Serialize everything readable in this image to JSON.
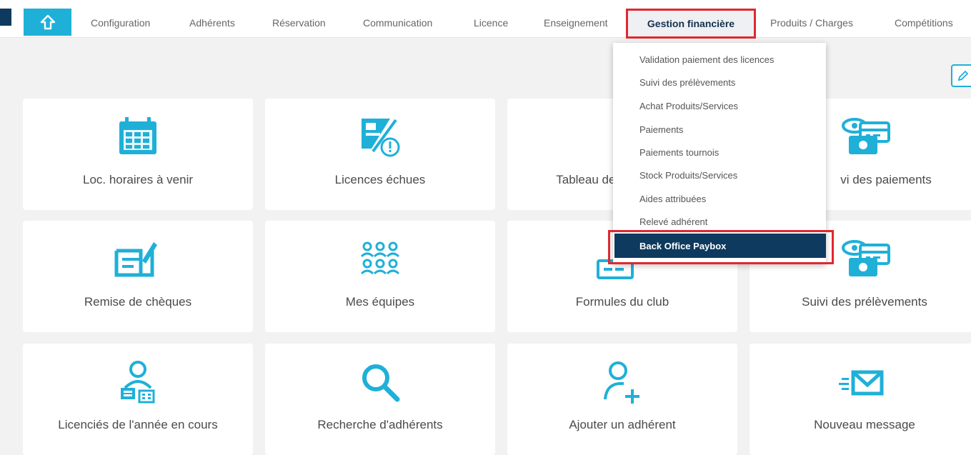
{
  "nav": {
    "items": [
      "Configuration",
      "Adhérents",
      "Réservation",
      "Communication",
      "Licence",
      "Enseignement"
    ],
    "active": "Gestion financière",
    "after": [
      "Produits / Charges",
      "Compétitions"
    ]
  },
  "dropdown": {
    "items": [
      "Validation paiement des licences",
      "Suivi des prélèvements",
      "Achat Produits/Services",
      "Paiements",
      "Paiements tournois",
      "Stock Produits/Services",
      "Aides attribuées",
      "Relevé adhérent"
    ],
    "selected": "Back Office Paybox"
  },
  "tiles": {
    "row1": [
      "Loc. horaires à venir",
      "Licences échues",
      "Tableau de rés",
      "vi des paiements"
    ],
    "row2": [
      "Remise de chèques",
      "Mes équipes",
      "Formules du club",
      "Suivi des prélèvements"
    ],
    "row3": [
      "Licenciés de l'année en cours",
      "Recherche d'adhérents",
      "Ajouter un adhérent",
      "Nouveau message"
    ]
  },
  "colors": {
    "accent": "#1fb0d8",
    "navy": "#0d3a5e",
    "highlight": "#e0282f"
  },
  "icons": {
    "home": "home-icon",
    "edit": "pencil-icon"
  }
}
